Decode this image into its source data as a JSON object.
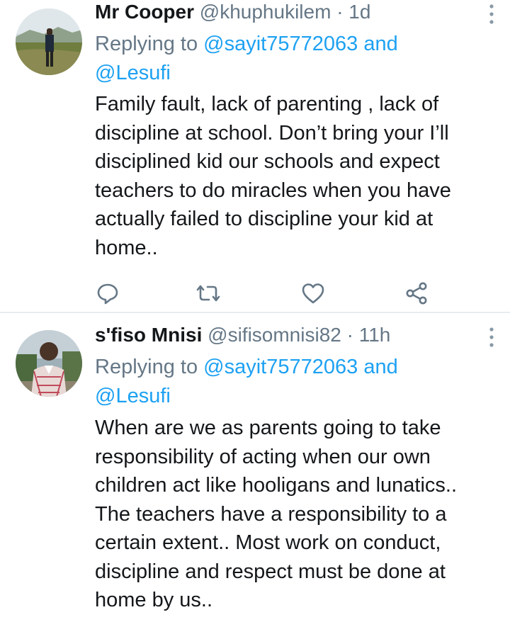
{
  "tweets": [
    {
      "name": "Mr Cooper",
      "handle": "@khuphukilem",
      "separator": "·",
      "time": "1d",
      "replying_prefix": "Replying to",
      "reply_to_1": "@sayit75772063",
      "reply_and": "and",
      "reply_to_2": "@Lesufi",
      "text": "Family fault, lack of parenting , lack of\ndiscipline at school. Don’t bring your I’ll\ndisciplined kid our schools and expect\nteachers to do miracles when you have\nactually failed to discipline your kid at\nhome..",
      "actions": [
        "reply-icon",
        "retweet-icon",
        "like-icon",
        "share-icon"
      ]
    },
    {
      "name": "s'fiso Mnisi",
      "handle": "@sifisomnisi82",
      "separator": "·",
      "time": "11h",
      "replying_prefix": "Replying to",
      "reply_to_1": "@sayit75772063",
      "reply_and": "and",
      "reply_to_2": "@Lesufi",
      "text": "When are we as parents going to take\nresponsibility of acting when our own\nchildren act like hooligans and lunatics..\nThe teachers have a responsibility to a\ncertain extent.. Most work on conduct,\ndiscipline and respect must be done  at\nhome by us..",
      "actions": []
    }
  ],
  "colors": {
    "text": "#14171a",
    "secondary": "#657786",
    "link": "#1da1f2",
    "divider": "#e6ecf0"
  }
}
